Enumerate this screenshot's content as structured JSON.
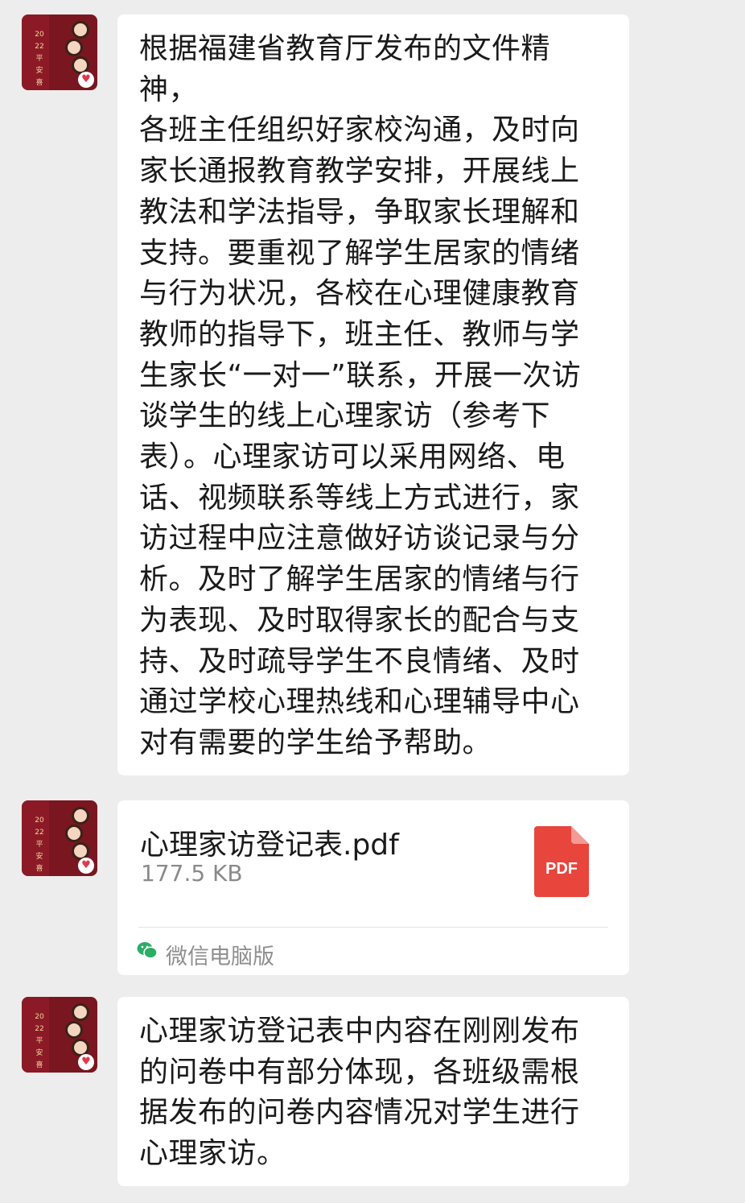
{
  "messages": [
    {
      "type": "text",
      "text": "根据福建省教育厅发布的文件精神，\n各班主任组织好家校沟通，及时向家长通报教育教学安排，开展线上教法和学法指导，争取家长理解和支持。要重视了解学生居家的情绪与行为状况，各校在心理健康教育教师的指导下，班主任、教师与学生家长“一对一”联系，开展一次访谈学生的线上心理家访（参考下表）。心理家访可以采用网络、电话、视频联系等线上方式进行，家访过程中应注意做好访谈记录与分析。及时了解学生居家的情绪与行为表现、及时取得家长的配合与支持、及时疏导学生不良情绪、及时通过学校心理热线和心理辅导中心对有需要的学生给予帮助。"
    },
    {
      "type": "file",
      "file_name": "心理家访登记表.pdf",
      "file_size": "177.5 KB",
      "file_type_label": "PDF",
      "source": "微信电脑版"
    },
    {
      "type": "text",
      "text": "心理家访登记表中内容在刚刚发布的问卷中有部分体现，各班级需根据发布的问卷内容情况对学生进行心理家访。"
    }
  ],
  "avatar": {
    "calendar_text": "2022平安喜乐",
    "badge_icon": "heart-icon"
  },
  "colors": {
    "background": "#ededed",
    "bubble": "#ffffff",
    "pdf_red": "#e8453c",
    "wechat_green": "#2aae67",
    "avatar_red": "#7a1620"
  }
}
